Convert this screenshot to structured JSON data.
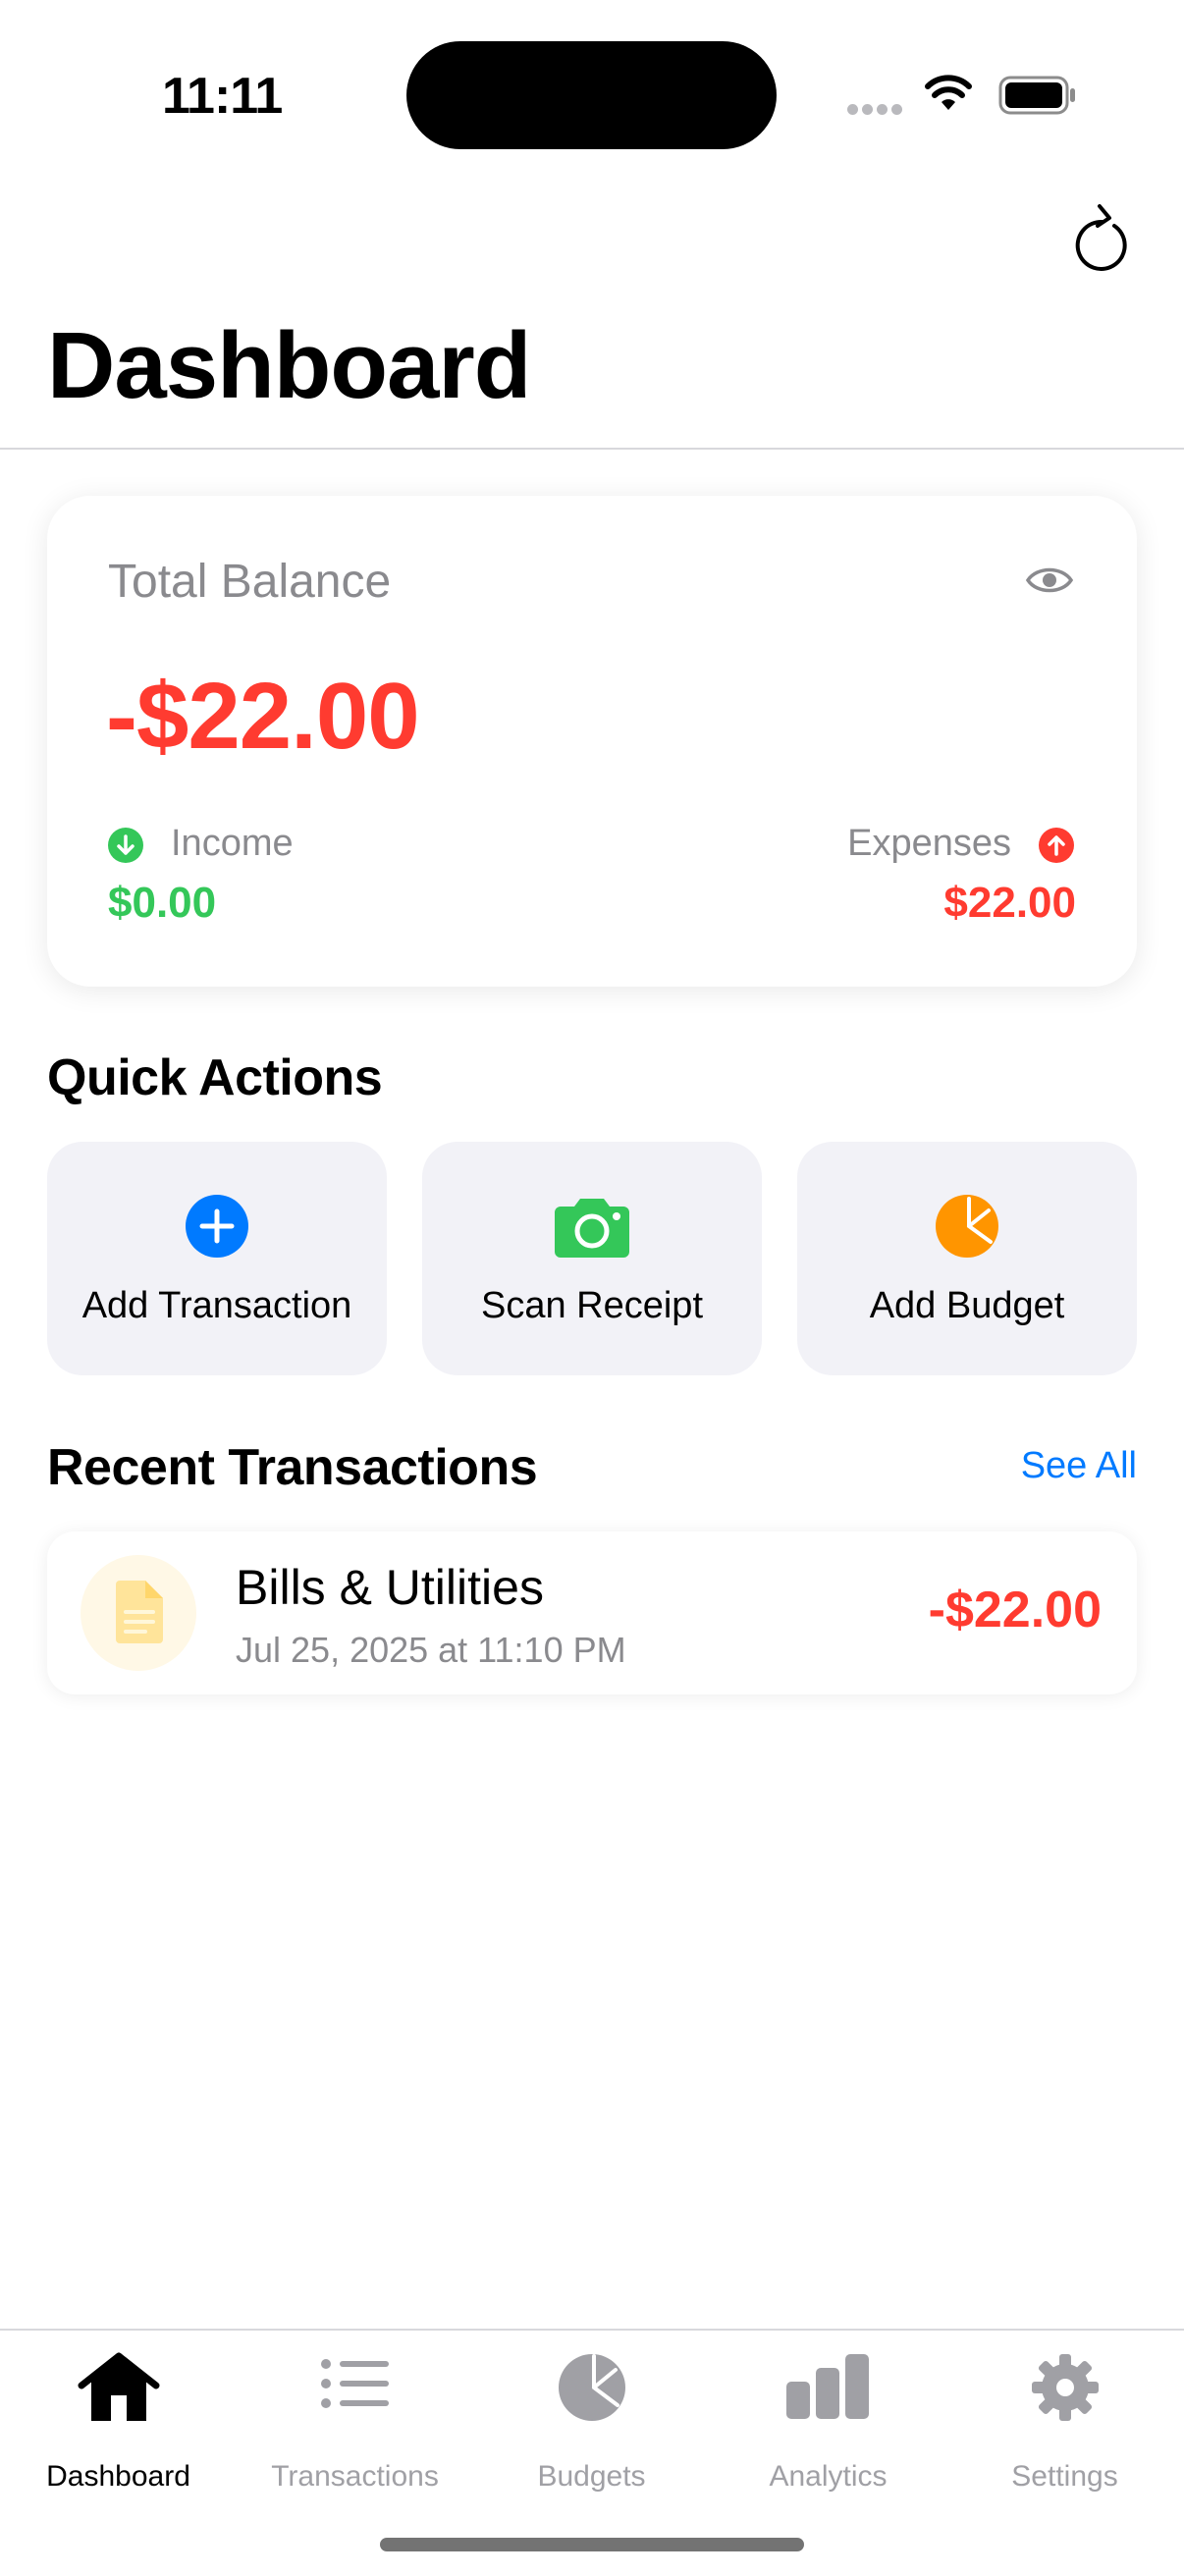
{
  "status_bar": {
    "time": "11:11"
  },
  "header": {
    "title": "Dashboard",
    "refresh_icon": "refresh-icon"
  },
  "balance_card": {
    "label": "Total Balance",
    "amount": "-$22.00",
    "income_label": "Income",
    "income_value": "$0.00",
    "expenses_label": "Expenses",
    "expenses_value": "$22.00",
    "colors": {
      "negative": "#ff3b30",
      "positive": "#34c759"
    }
  },
  "quick_actions": {
    "title": "Quick Actions",
    "items": [
      {
        "label": "Add Transaction",
        "icon": "plus-circle-icon",
        "color": "#007aff"
      },
      {
        "label": "Scan Receipt",
        "icon": "camera-icon",
        "color": "#34c759"
      },
      {
        "label": "Add Budget",
        "icon": "pie-chart-icon",
        "color": "#ff9500"
      }
    ]
  },
  "recent_transactions": {
    "title": "Recent Transactions",
    "see_all": "See All",
    "items": [
      {
        "name": "Bills & Utilities",
        "date": "Jul 25, 2025 at 11:10 PM",
        "amount": "-$22.00",
        "icon": "document-icon"
      }
    ]
  },
  "tab_bar": {
    "tabs": [
      {
        "label": "Dashboard",
        "icon": "house-icon",
        "active": true
      },
      {
        "label": "Transactions",
        "icon": "list-icon",
        "active": false
      },
      {
        "label": "Budgets",
        "icon": "pie-chart-icon",
        "active": false
      },
      {
        "label": "Analytics",
        "icon": "bar-chart-icon",
        "active": false
      },
      {
        "label": "Settings",
        "icon": "gear-icon",
        "active": false
      }
    ]
  }
}
